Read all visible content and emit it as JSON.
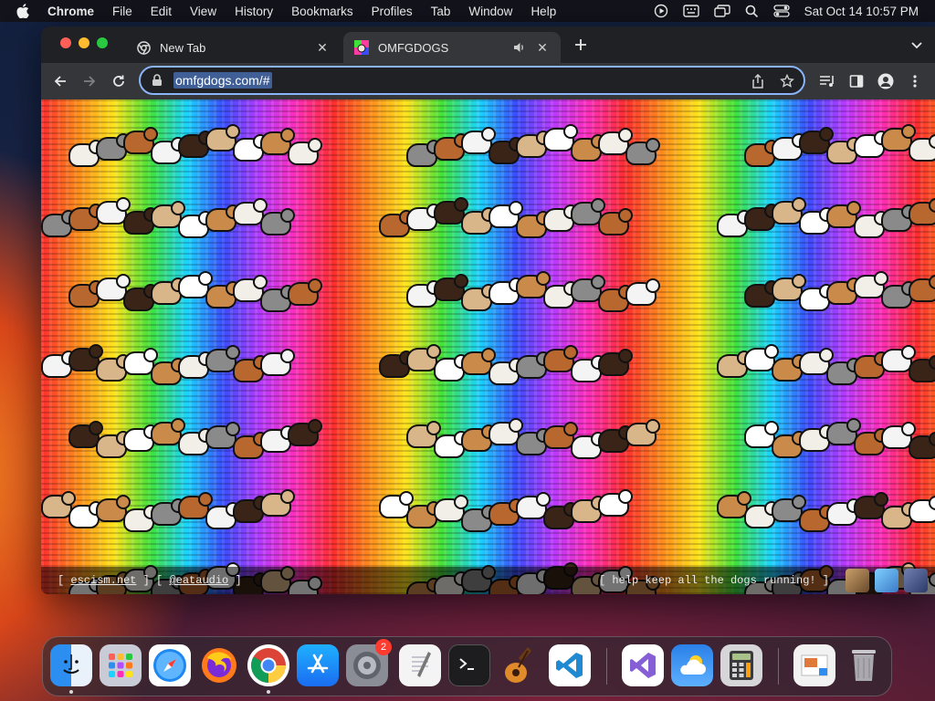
{
  "menubar": {
    "app_name": "Chrome",
    "items": [
      "File",
      "Edit",
      "View",
      "History",
      "Bookmarks",
      "Profiles",
      "Tab",
      "Window",
      "Help"
    ],
    "clock": "Sat Oct 14  10:57 PM"
  },
  "tabs": [
    {
      "title": "New Tab",
      "active": false
    },
    {
      "title": "OMFGDOGS",
      "active": true
    }
  ],
  "omnibox": {
    "url": "omfgdogs.com/#"
  },
  "footer": {
    "left_open": "[ ",
    "link1": "escism.net",
    "mid": " ] [ ",
    "link2": "@eataudio",
    "left_close": " ]",
    "right_text": "[ help keep all the dogs running! ]"
  },
  "dock": {
    "items": [
      {
        "name": "Finder",
        "icon": "finder-icon"
      },
      {
        "name": "Launchpad",
        "icon": "launchpad-icon"
      },
      {
        "name": "Safari",
        "icon": "safari-icon"
      },
      {
        "name": "Firefox",
        "icon": "firefox-icon"
      },
      {
        "name": "Chrome",
        "icon": "chrome-icon"
      },
      {
        "name": "App Store",
        "icon": "app-store-icon"
      },
      {
        "name": "System Settings",
        "icon": "settings-icon",
        "badge": "2"
      },
      {
        "name": "TextEdit",
        "icon": "textedit-icon"
      },
      {
        "name": "Terminal",
        "icon": "terminal-icon"
      },
      {
        "name": "GarageBand",
        "icon": "garageband-icon"
      },
      {
        "name": "VS Code",
        "icon": "vscode-icon"
      },
      {
        "name": "Visual Studio",
        "icon": "visual-studio-icon"
      },
      {
        "name": "Weather",
        "icon": "weather-icon"
      },
      {
        "name": "Calculator",
        "icon": "calculator-icon"
      },
      {
        "name": "Preview",
        "icon": "preview-icon"
      },
      {
        "name": "Trash",
        "icon": "trash-icon"
      }
    ]
  },
  "colors": {
    "omnibox_border": "#8ab4f8",
    "url_highlight": "#3f5f96",
    "badge": "#ff3b30"
  }
}
